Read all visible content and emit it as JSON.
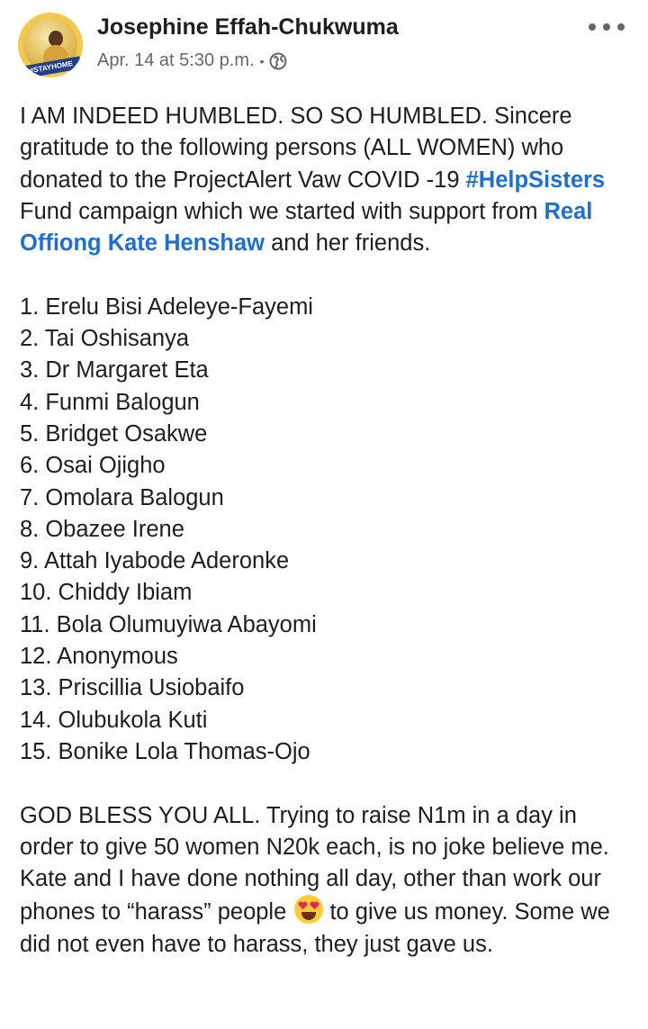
{
  "post": {
    "author": "Josephine Effah-Chukwuma",
    "avatar_badge": "#STAYHOME",
    "timestamp": "Apr. 14 at 5:30 p.m.",
    "separator": "•",
    "privacy_icon": "globe-icon",
    "more_icon": "more-options-icon"
  },
  "body": {
    "intro_1": "I AM INDEED HUMBLED. SO SO HUMBLED. Sincere gratitude to the following persons (ALL WOMEN) who donated to the ProjectAlert Vaw COVID -19 ",
    "hashtag": "#HelpSisters",
    "intro_2": " Fund campaign which we started with support from ",
    "mention": "Real Offiong Kate Henshaw",
    "intro_3": " and her friends.",
    "donors": [
      "1. Erelu Bisi Adeleye-Fayemi",
      "2. Tai Oshisanya",
      "3. Dr Margaret Eta",
      "4. Funmi Balogun",
      "5. Bridget Osakwe",
      "6. Osai Ojigho",
      "7. Omolara Balogun",
      "8. Obazee Irene",
      "9. Attah Iyabode Aderonke",
      "10. Chiddy Ibiam",
      "11. Bola Olumuyiwa Abayomi",
      "12. Anonymous",
      "13. Priscillia Usiobaifo",
      "14. Olubukola Kuti",
      "15. Bonike Lola Thomas-Ojo"
    ],
    "closing_1": "GOD BLESS YOU ALL. Trying to raise N1m in a day in order to give 50 women N20k each, is no joke believe me. Kate and I have done nothing all day, other than work our phones to “harass” people",
    "emoji": "heart-eyes-emoji",
    "closing_2": " to give us money. Some we did not even have to harass, they just gave us."
  },
  "colors": {
    "link": "#1f6fd1",
    "text": "#1c1e21",
    "meta": "#65676b"
  }
}
